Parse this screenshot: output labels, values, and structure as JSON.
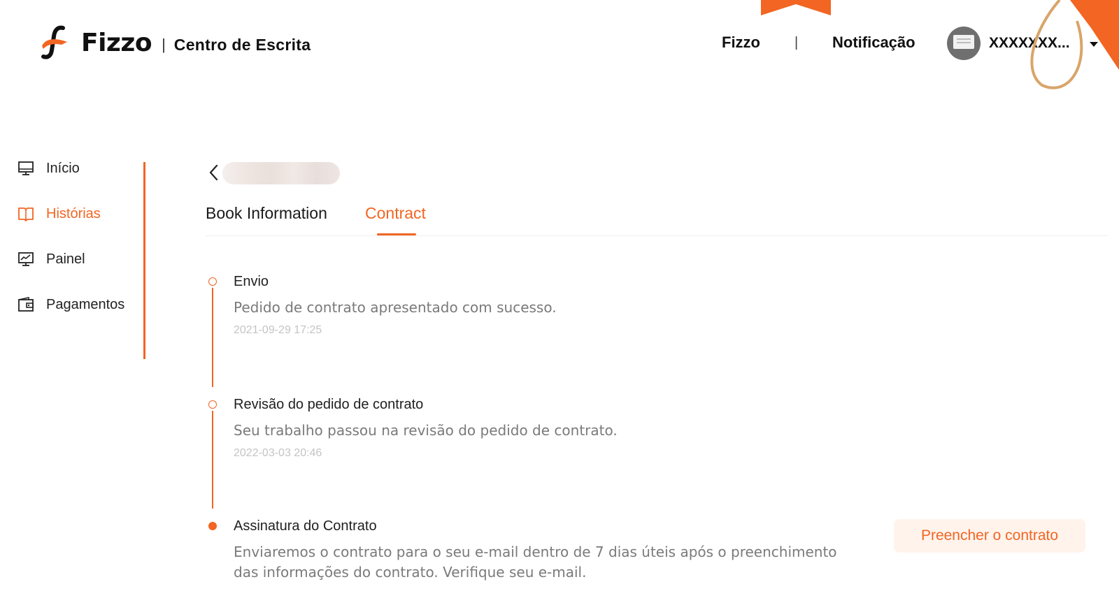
{
  "header": {
    "logo_text": "Fizzo",
    "logo_separator": "|",
    "subtitle": "Centro de Escrita",
    "nav_fizzo": "Fizzo",
    "nav_separator": "|",
    "nav_notification": "Notificação",
    "username": "XXXXXXX..."
  },
  "sidebar": {
    "items": [
      {
        "label": "Início",
        "icon": "monitor-icon",
        "active": false
      },
      {
        "label": "Histórias",
        "icon": "book-icon",
        "active": true
      },
      {
        "label": "Painel",
        "icon": "chart-icon",
        "active": false
      },
      {
        "label": "Pagamentos",
        "icon": "wallet-icon",
        "active": false
      }
    ]
  },
  "tabs": [
    {
      "label": "Book Information",
      "active": false
    },
    {
      "label": "Contract",
      "active": true
    }
  ],
  "timeline": [
    {
      "title": "Envio",
      "description": "Pedido de contrato apresentado com sucesso.",
      "time": "2021-09-29 17:25",
      "state": "done"
    },
    {
      "title": "Revisão do pedido de contrato",
      "description": "Seu trabalho passou na revisão do pedido de contrato.",
      "time": "2022-03-03 20:46",
      "state": "done"
    },
    {
      "title": "Assinatura do Contrato",
      "description_line1": "Enviaremos o contrato para o seu e-mail dentro de 7 dias úteis após o preenchimento",
      "description_line2": "das informações do contrato. Verifique seu e-mail.",
      "state": "current"
    }
  ],
  "actions": {
    "fill_contract": "Preencher o contrato"
  },
  "colors": {
    "accent": "#f26522",
    "button_bg": "#fff3ec",
    "muted_text": "#7a7a7a",
    "time_text": "#c4c4c4"
  }
}
